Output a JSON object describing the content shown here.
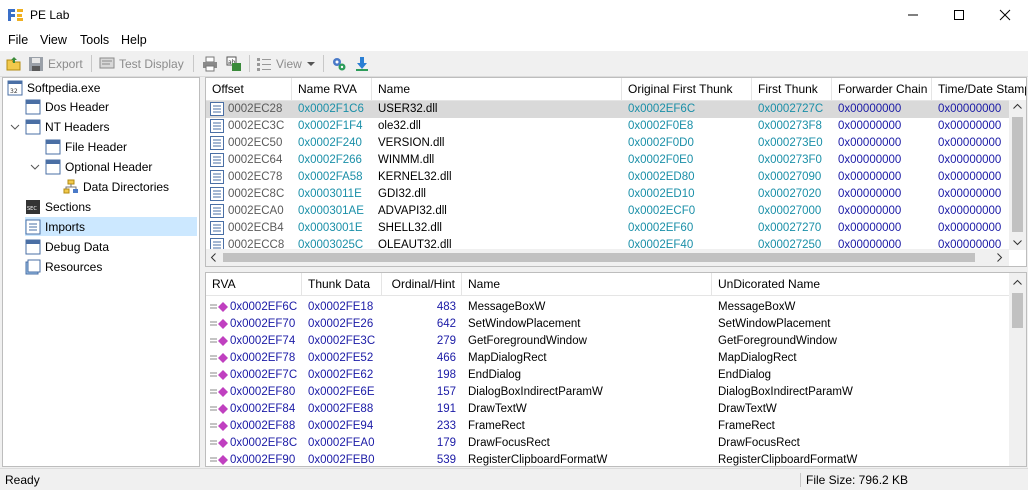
{
  "window": {
    "title": "PE Lab"
  },
  "menu": [
    "File",
    "View",
    "Tools",
    "Help"
  ],
  "toolbar": {
    "export": "Export",
    "test_display": "Test Display",
    "view": "View"
  },
  "tree": {
    "root": "Softpedia.exe",
    "items": [
      "Dos Header",
      "NT Headers",
      "File Header",
      "Optional Header",
      "Data Directories",
      "Sections",
      "Imports",
      "Debug Data",
      "Resources"
    ],
    "selected": "Imports"
  },
  "imports_table": {
    "columns": [
      "Offset",
      "Name RVA",
      "Name",
      "Original First Thunk",
      "First Thunk",
      "Forwarder Chain",
      "Time/Date Stamp"
    ],
    "rows": [
      [
        "0002EC28",
        "0x0002F1C6",
        "USER32.dll",
        "0x0002EF6C",
        "0x0002727C",
        "0x00000000",
        "0x00000000"
      ],
      [
        "0002EC3C",
        "0x0002F1F4",
        "ole32.dll",
        "0x0002F0E8",
        "0x000273F8",
        "0x00000000",
        "0x00000000"
      ],
      [
        "0002EC50",
        "0x0002F240",
        "VERSION.dll",
        "0x0002F0D0",
        "0x000273E0",
        "0x00000000",
        "0x00000000"
      ],
      [
        "0002EC64",
        "0x0002F266",
        "WINMM.dll",
        "0x0002F0E0",
        "0x000273F0",
        "0x00000000",
        "0x00000000"
      ],
      [
        "0002EC78",
        "0x0002FA58",
        "KERNEL32.dll",
        "0x0002ED80",
        "0x00027090",
        "0x00000000",
        "0x00000000"
      ],
      [
        "0002EC8C",
        "0x0003011E",
        "GDI32.dll",
        "0x0002ED10",
        "0x00027020",
        "0x00000000",
        "0x00000000"
      ],
      [
        "0002ECA0",
        "0x000301AE",
        "ADVAPI32.dll",
        "0x0002ECF0",
        "0x00027000",
        "0x00000000",
        "0x00000000"
      ],
      [
        "0002ECB4",
        "0x0003001E",
        "SHELL32.dll",
        "0x0002EF60",
        "0x00027270",
        "0x00000000",
        "0x00000000"
      ],
      [
        "0002ECC8",
        "0x0003025C",
        "OLEAUT32.dll",
        "0x0002EF40",
        "0x00027250",
        "0x00000000",
        "0x00000000"
      ]
    ]
  },
  "thunk_table": {
    "columns": [
      "RVA",
      "Thunk Data",
      "Ordinal/Hint",
      "Name",
      "UnDicorated Name"
    ],
    "rows": [
      [
        "0x0002EF6C",
        "0x0002FE18",
        "483",
        "MessageBoxW",
        "MessageBoxW"
      ],
      [
        "0x0002EF70",
        "0x0002FE26",
        "642",
        "SetWindowPlacement",
        "SetWindowPlacement"
      ],
      [
        "0x0002EF74",
        "0x0002FE3C",
        "279",
        "GetForegroundWindow",
        "GetForegroundWindow"
      ],
      [
        "0x0002EF78",
        "0x0002FE52",
        "466",
        "MapDialogRect",
        "MapDialogRect"
      ],
      [
        "0x0002EF7C",
        "0x0002FE62",
        "198",
        "EndDialog",
        "EndDialog"
      ],
      [
        "0x0002EF80",
        "0x0002FE6E",
        "157",
        "DialogBoxIndirectParamW",
        "DialogBoxIndirectParamW"
      ],
      [
        "0x0002EF84",
        "0x0002FE88",
        "191",
        "DrawTextW",
        "DrawTextW"
      ],
      [
        "0x0002EF88",
        "0x0002FE94",
        "233",
        "FrameRect",
        "FrameRect"
      ],
      [
        "0x0002EF8C",
        "0x0002FEA0",
        "179",
        "DrawFocusRect",
        "DrawFocusRect"
      ],
      [
        "0x0002EF90",
        "0x0002FEB0",
        "539",
        "RegisterClipboardFormatW",
        "RegisterClipboardFormatW"
      ]
    ]
  },
  "status": {
    "left": "Ready",
    "right": "File Size: 796.2 KB"
  }
}
